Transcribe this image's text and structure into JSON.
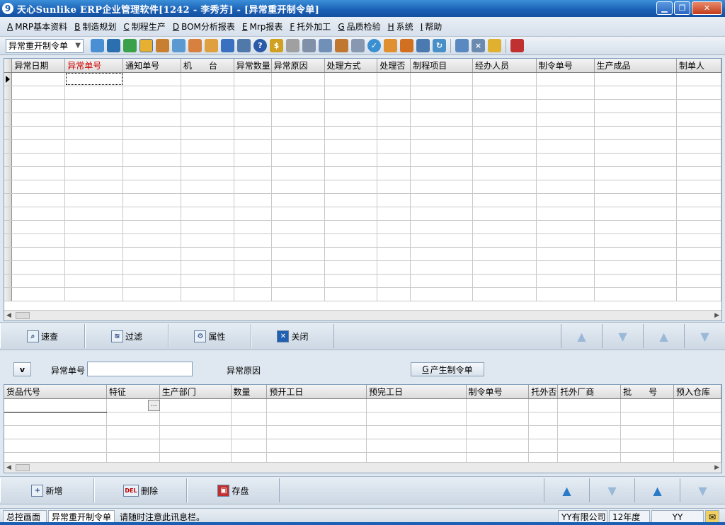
{
  "window": {
    "title": "天心Sunlike ERP企业管理软件[1242 - 李秀芳] - [异常重开制令单]",
    "logo": "9"
  },
  "menu": [
    {
      "hotkey": "A",
      "label": "MRP基本资料"
    },
    {
      "hotkey": "B",
      "label": "制造规划"
    },
    {
      "hotkey": "C",
      "label": "制程生产"
    },
    {
      "hotkey": "D",
      "label": "BOM分析报表"
    },
    {
      "hotkey": "E",
      "label": "Mrp报表"
    },
    {
      "hotkey": "F",
      "label": "托外加工"
    },
    {
      "hotkey": "G",
      "label": "品质检验"
    },
    {
      "hotkey": "H",
      "label": "系统"
    },
    {
      "hotkey": "I",
      "label": "帮助"
    }
  ],
  "toolbar": {
    "selected_form": "异常重开制令单"
  },
  "top_grid": {
    "columns": [
      "异常日期",
      "异常单号",
      "通知单号",
      "机　　台",
      "异常数量",
      "异常原因",
      "处理方式",
      "处理否",
      "制程项目",
      "经办人员",
      "制令单号",
      "生产成品",
      "制单人"
    ]
  },
  "top_buttons": {
    "query": "速查",
    "filter": "过滤",
    "props": "属性",
    "close": "关闭"
  },
  "form": {
    "toggle": "v",
    "abnormal_no_label": "异常单号",
    "abnormal_no_value": "",
    "reason_label": "异常原因",
    "generate_hotkey": "G",
    "generate_label": "产生制令单"
  },
  "bottom_grid": {
    "columns": [
      "货品代号",
      "特征",
      "生产部门",
      "数量",
      "预开工日",
      "预完工日",
      "制令单号",
      "托外否",
      "托外厂商",
      "批　　号",
      "预入仓库"
    ],
    "ellipsis": "..."
  },
  "bottom_buttons": {
    "add": "新增",
    "add_icon": "+",
    "del_icon": "DEL",
    "delete": "删除",
    "save": "存盘"
  },
  "status": {
    "home": "总控画面",
    "active_tab": "异常重开制令单",
    "message": "请随时注意此讯息栏。",
    "company": "YY有限公司",
    "year": "12年度",
    "user": "YY"
  }
}
